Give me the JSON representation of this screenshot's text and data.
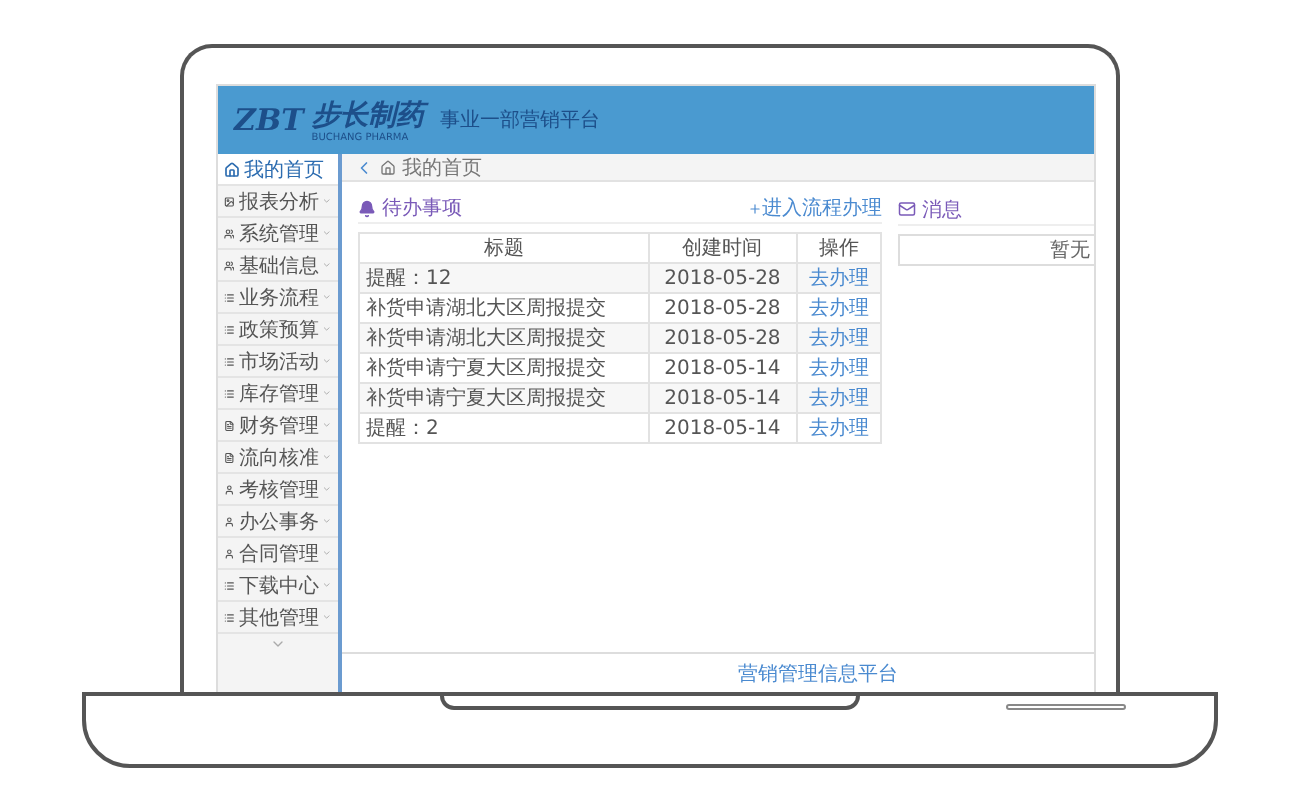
{
  "header": {
    "logo_mark": "ZBT",
    "brand": "步长制药",
    "brand_en": "BUCHANG PHARMA",
    "platform": "事业一部营销平台"
  },
  "sidebar": {
    "items": [
      {
        "label": "我的首页",
        "kind": "home",
        "selected": true
      },
      {
        "label": "报表分析",
        "kind": "image",
        "selected": false
      },
      {
        "label": "系统管理",
        "kind": "group",
        "selected": false
      },
      {
        "label": "基础信息",
        "kind": "group",
        "selected": false
      },
      {
        "label": "业务流程",
        "kind": "list",
        "selected": false
      },
      {
        "label": "政策预算",
        "kind": "list",
        "selected": false
      },
      {
        "label": "市场活动",
        "kind": "list",
        "selected": false
      },
      {
        "label": "库存管理",
        "kind": "list",
        "selected": false
      },
      {
        "label": "财务管理",
        "kind": "doc",
        "selected": false
      },
      {
        "label": "流向核准",
        "kind": "doc",
        "selected": false
      },
      {
        "label": "考核管理",
        "kind": "person",
        "selected": false
      },
      {
        "label": "办公事务",
        "kind": "person",
        "selected": false
      },
      {
        "label": "合同管理",
        "kind": "person",
        "selected": false
      },
      {
        "label": "下载中心",
        "kind": "list",
        "selected": false
      },
      {
        "label": "其他管理",
        "kind": "list",
        "selected": false
      }
    ]
  },
  "breadcrumb": "我的首页",
  "todo": {
    "title": "待办事项",
    "action": "进入流程办理",
    "columns": [
      "标题",
      "创建时间",
      "操作"
    ],
    "rows": [
      {
        "title": "提醒：12",
        "date": "2018-05-28",
        "action": "去办理"
      },
      {
        "title": "补货申请湖北大区周报提交",
        "date": "2018-05-28",
        "action": "去办理"
      },
      {
        "title": "补货申请湖北大区周报提交",
        "date": "2018-05-28",
        "action": "去办理"
      },
      {
        "title": "补货申请宁夏大区周报提交",
        "date": "2018-05-14",
        "action": "去办理"
      },
      {
        "title": "补货申请宁夏大区周报提交",
        "date": "2018-05-14",
        "action": "去办理"
      },
      {
        "title": "提醒：2",
        "date": "2018-05-14",
        "action": "去办理"
      }
    ]
  },
  "messages": {
    "title": "消息",
    "note": "暂无"
  },
  "footer": "营销管理信息平台"
}
